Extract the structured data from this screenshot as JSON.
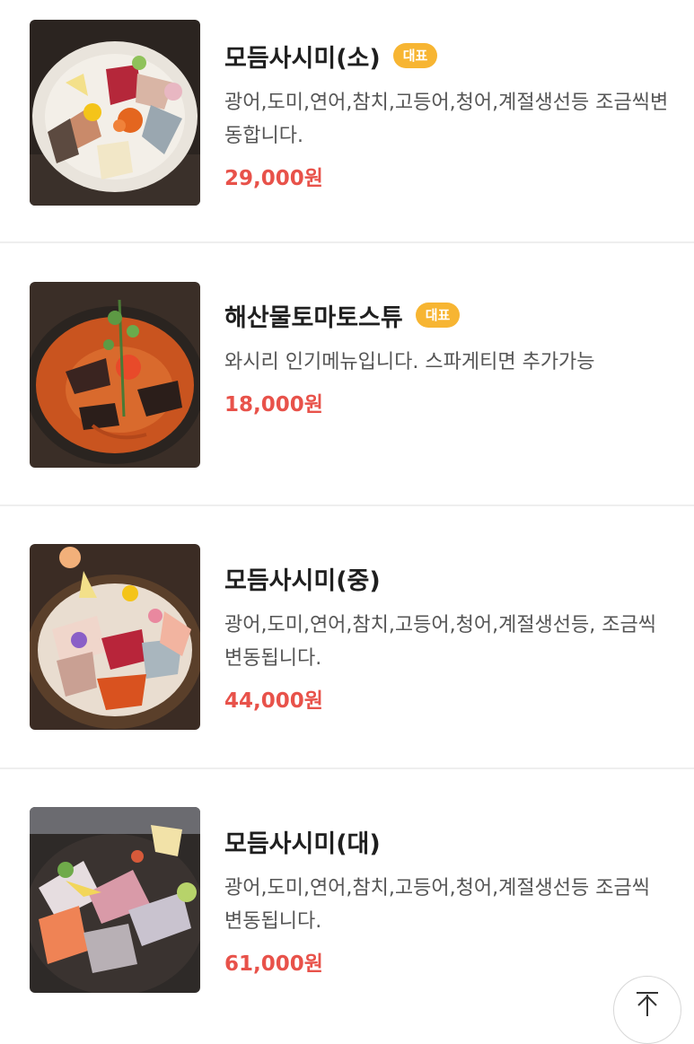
{
  "menu": {
    "items": [
      {
        "name": "모듬사시미(소)",
        "badge": "대표",
        "description": "광어,도미,연어,참치,고등어,청어,계절생선등 조금씩변동합니다.",
        "price": "29,000원",
        "image": "assorted-sashimi-plate-photo"
      },
      {
        "name": "해산물토마토스튜",
        "badge": "대표",
        "description": "와시리 인기메뉴입니다. 스파게티면 추가가능",
        "price": "18,000원",
        "image": "seafood-tomato-stew-photo"
      },
      {
        "name": "모듬사시미(중)",
        "badge": "",
        "description": "광어,도미,연어,참치,고등어,청어,계절생선등, 조금씩 변동됩니다.",
        "price": "44,000원",
        "image": "assorted-sashimi-bowl-photo"
      },
      {
        "name": "모듬사시미(대)",
        "badge": "",
        "description": "광어,도미,연어,참치,고등어,청어,계절생선등 조금씩 변동됩니다.",
        "price": "61,000원",
        "image": "large-sashimi-platter-photo"
      }
    ]
  },
  "scroll_top": {
    "icon": "arrow-up-to-top-icon"
  },
  "colors": {
    "price": "#e8524a",
    "badge": "#f7b532",
    "divider": "#eeeeee"
  }
}
